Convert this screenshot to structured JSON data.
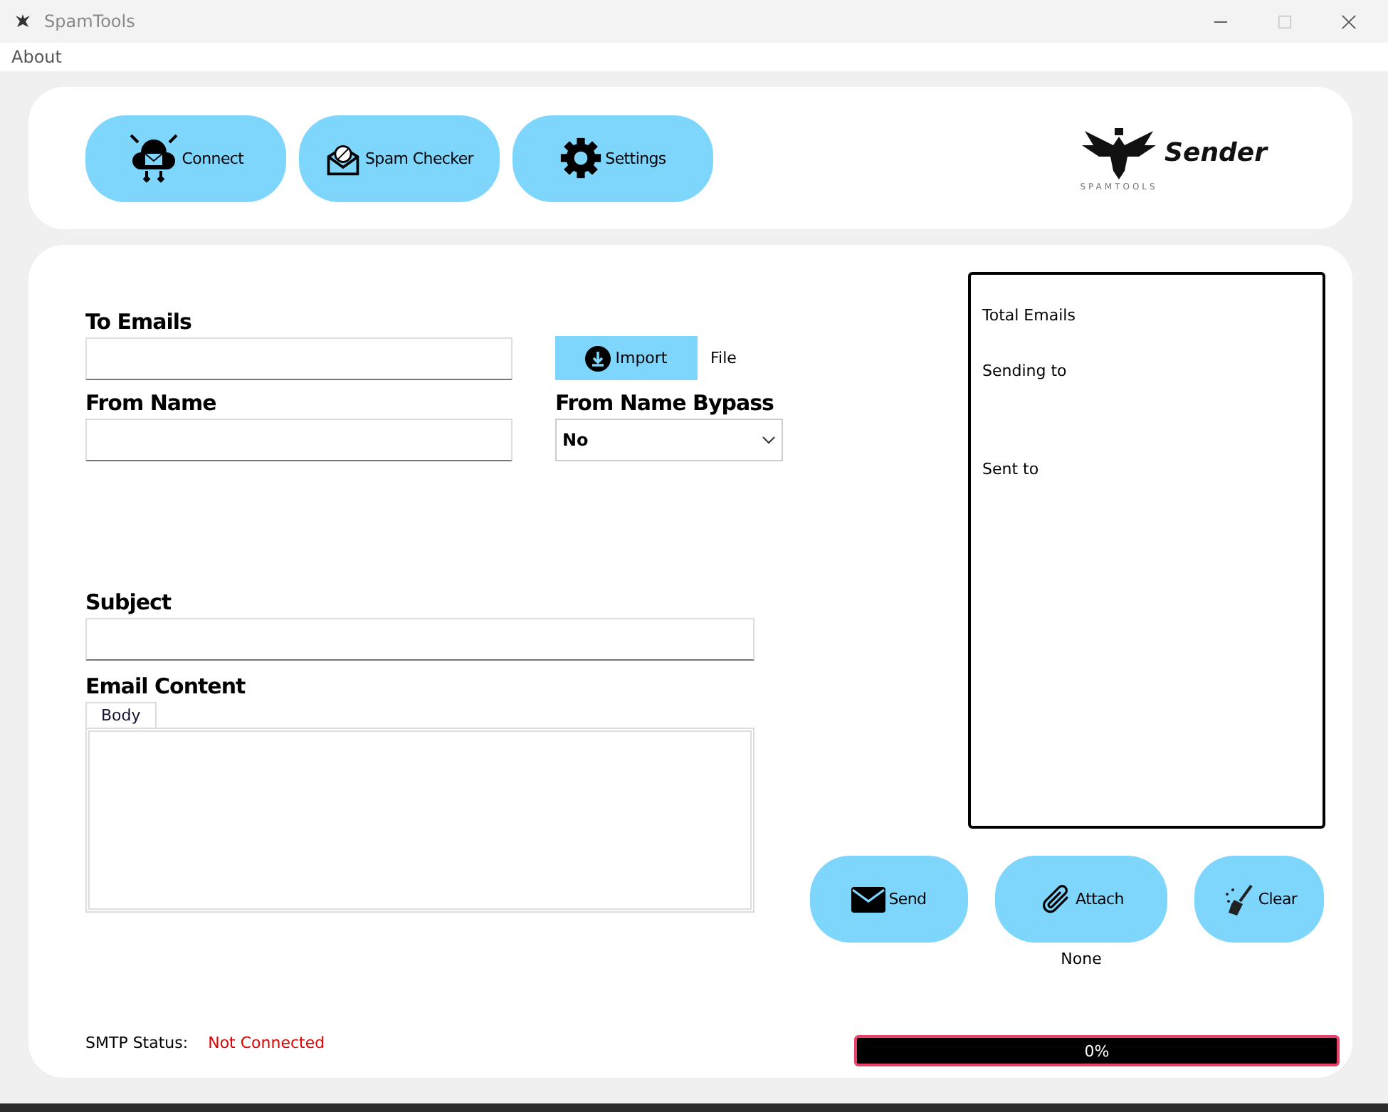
{
  "window": {
    "title": "SpamTools"
  },
  "menu": [
    "About"
  ],
  "toolbar": [
    {
      "kind": "connect",
      "label": "Connect"
    },
    {
      "kind": "spam",
      "label": "Spam Checker"
    },
    {
      "kind": "settings",
      "label": "Settings"
    }
  ],
  "logo": {
    "name": "Sender",
    "tagline": "SPAMTOOLS"
  },
  "form": {
    "to_label": "To Emails",
    "import_button": "Import",
    "file_label": "File",
    "from_name_label": "From Name",
    "bypass_label": "From Name Bypass",
    "bypass_value": "No",
    "subject_label": "Subject",
    "content_label": "Email Content",
    "content_tabs": [
      {
        "label": "Body",
        "selected": true
      }
    ]
  },
  "log": {
    "lines": [
      "Total Emails",
      "Sending to",
      "Sent to"
    ]
  },
  "actions": [
    {
      "kind": "send",
      "label": "Send"
    },
    {
      "kind": "attach",
      "label": "Attach"
    },
    {
      "kind": "clear",
      "label": "Clear"
    }
  ],
  "attachment": "None",
  "smtp": {
    "label": "SMTP Status:",
    "value": "Not Connected",
    "connected": false
  },
  "progress": {
    "level": 0,
    "text": "0%"
  }
}
